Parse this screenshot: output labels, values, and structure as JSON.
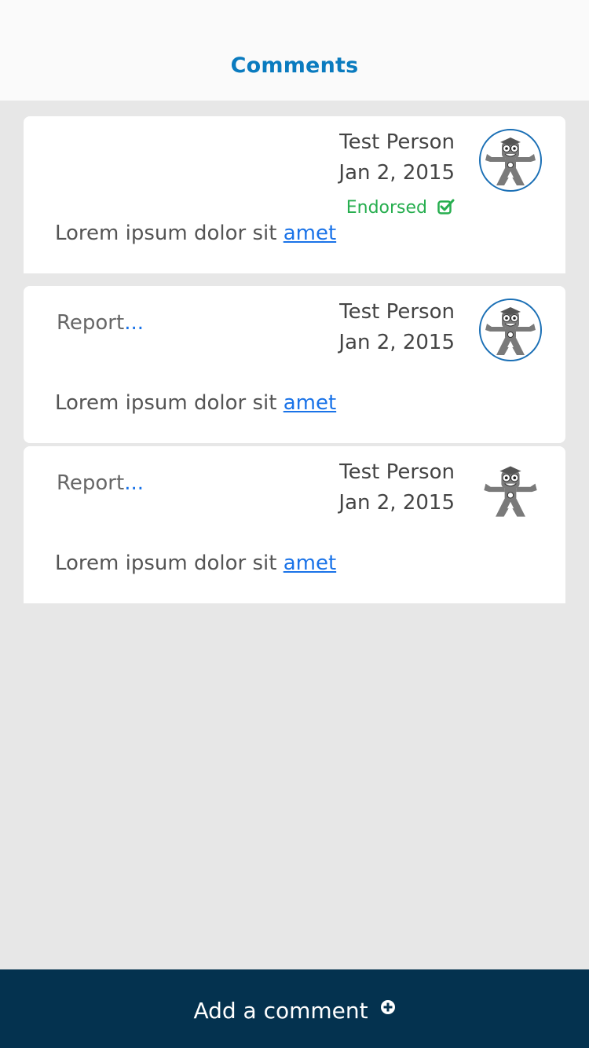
{
  "header": {
    "title": "Comments"
  },
  "comments": [
    {
      "author": "Test Person",
      "date": "Jan 2, 2015",
      "endorsed_label": "Endorsed",
      "text": "Lorem ipsum dolor sit ",
      "link_text": "amet",
      "avatar_icon": "mascot-avatar-icon"
    },
    {
      "report_label": "Report",
      "report_dots": "...",
      "author": "Test Person",
      "date": "Jan 2, 2015",
      "text": "Lorem ipsum dolor sit ",
      "link_text": "amet",
      "avatar_icon": "mascot-avatar-icon"
    },
    {
      "report_label": "Report",
      "report_dots": "...",
      "author": "Test Person",
      "date": "Jan 2, 2015",
      "text": "Lorem ipsum dolor sit ",
      "link_text": "amet",
      "avatar_icon": "mascot-avatar-icon"
    }
  ],
  "footer": {
    "add_comment_label": "Add a comment"
  },
  "colors": {
    "accent": "#0a7bbf",
    "link": "#1a73e8",
    "endorsed": "#27ae4f",
    "footer_bg": "#04324f",
    "background": "#e7e7e7"
  }
}
